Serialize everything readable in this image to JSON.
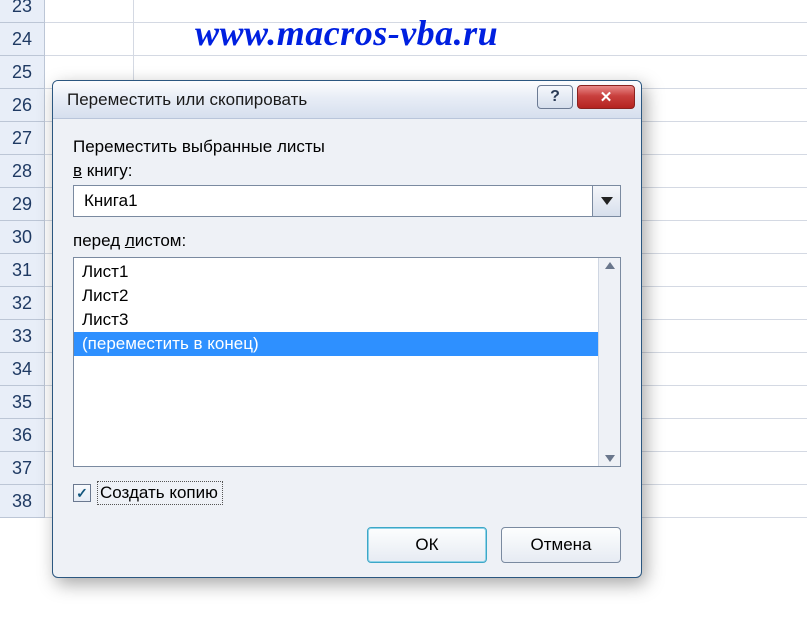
{
  "watermark": "www.macros-vba.ru",
  "rows": [
    "23",
    "24",
    "25",
    "26",
    "27",
    "28",
    "29",
    "30",
    "31",
    "32",
    "33",
    "34",
    "35",
    "36",
    "37",
    "38"
  ],
  "dialog": {
    "title": "Переместить или скопировать",
    "label_move_selected": "Переместить выбранные листы",
    "label_to_book": "в книгу:",
    "book_value": "Книга1",
    "label_before_sheet": "перед листом:",
    "sheets": [
      "Лист1",
      "Лист2",
      "Лист3",
      "(переместить в конец)"
    ],
    "selected_index": 3,
    "checkbox_label": "Создать копию",
    "checkbox_checked": true,
    "ok": "ОК",
    "cancel": "Отмена"
  }
}
